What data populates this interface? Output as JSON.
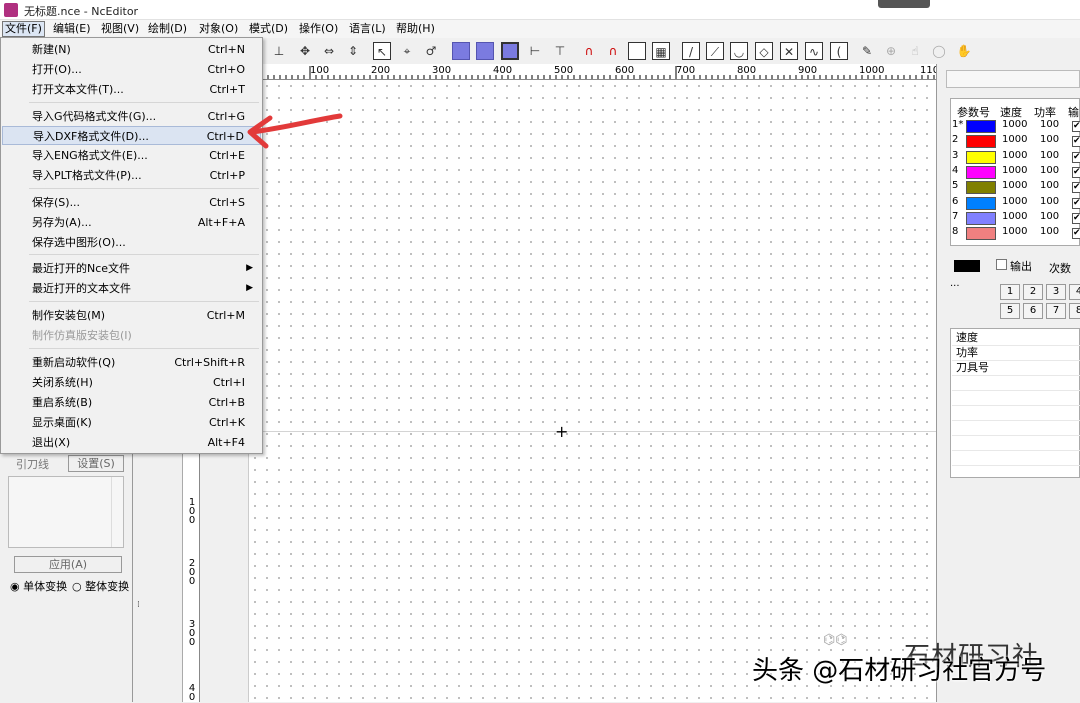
{
  "window": {
    "title": "无标题.nce - NcEditor"
  },
  "menubar": [
    {
      "label": "文件(F)"
    },
    {
      "label": "编辑(E)"
    },
    {
      "label": "视图(V)"
    },
    {
      "label": "绘制(D)"
    },
    {
      "label": "对象(O)"
    },
    {
      "label": "模式(D)"
    },
    {
      "label": "操作(O)"
    },
    {
      "label": "语言(L)"
    },
    {
      "label": "帮助(H)"
    }
  ],
  "file_menu": [
    {
      "label": "新建(N)",
      "shortcut": "Ctrl+N"
    },
    {
      "label": "打开(O)...",
      "shortcut": "Ctrl+O"
    },
    {
      "label": "打开文本文件(T)...",
      "shortcut": "Ctrl+T"
    },
    {
      "label": "导入G代码格式文件(G)...",
      "shortcut": "Ctrl+G"
    },
    {
      "label": "导入DXF格式文件(D)...",
      "shortcut": "Ctrl+D"
    },
    {
      "label": "导入ENG格式文件(E)...",
      "shortcut": "Ctrl+E"
    },
    {
      "label": "导入PLT格式文件(P)...",
      "shortcut": "Ctrl+P"
    },
    {
      "label": "保存(S)...",
      "shortcut": "Ctrl+S"
    },
    {
      "label": "另存为(A)...",
      "shortcut": "Alt+F+A"
    },
    {
      "label": "保存选中图形(O)...",
      "shortcut": ""
    },
    {
      "label": "最近打开的Nce文件",
      "shortcut": "▶"
    },
    {
      "label": "最近打开的文本文件",
      "shortcut": "▶"
    },
    {
      "label": "制作安装包(M)",
      "shortcut": "Ctrl+M"
    },
    {
      "label": "制作仿真版安装包(I)",
      "shortcut": ""
    },
    {
      "label": "重新启动软件(Q)",
      "shortcut": "Ctrl+Shift+R"
    },
    {
      "label": "关闭系统(H)",
      "shortcut": "Ctrl+I"
    },
    {
      "label": "重启系统(B)",
      "shortcut": "Ctrl+B"
    },
    {
      "label": "显示桌面(K)",
      "shortcut": "Ctrl+K"
    },
    {
      "label": "退出(X)",
      "shortcut": "Alt+F4"
    }
  ],
  "ruler_top": [
    "100",
    "200",
    "300",
    "400",
    "500",
    "600",
    "700",
    "800",
    "900",
    "1000",
    "110"
  ],
  "ruler_left": [
    "1\n0\n0",
    "2\n0\n0",
    "3\n0\n0",
    "4\n0"
  ],
  "left_panel": {
    "lead_line": "引刀线",
    "settings": "设置(S)",
    "apply": "应用(A)",
    "single": "单体变换",
    "whole": "整体变换"
  },
  "param_table": {
    "headers": [
      "参数号",
      "速度",
      "功率",
      "输"
    ],
    "rows": [
      {
        "num": "1*",
        "color": "#0000ff",
        "speed": "1000",
        "power": "100"
      },
      {
        "num": "2",
        "color": "#ff0000",
        "speed": "1000",
        "power": "100"
      },
      {
        "num": "3",
        "color": "#ffff00",
        "speed": "1000",
        "power": "100"
      },
      {
        "num": "4",
        "color": "#ff00ff",
        "speed": "1000",
        "power": "100"
      },
      {
        "num": "5",
        "color": "#808000",
        "speed": "1000",
        "power": "100"
      },
      {
        "num": "6",
        "color": "#0080ff",
        "speed": "1000",
        "power": "100"
      },
      {
        "num": "7",
        "color": "#8080ff",
        "speed": "1000",
        "power": "100"
      },
      {
        "num": "8",
        "color": "#f08080",
        "speed": "1000",
        "power": "100"
      }
    ]
  },
  "output": {
    "label": "输出",
    "times": "次数",
    "dots": "...",
    "buttons": [
      "1",
      "2",
      "3",
      "4",
      "5",
      "6",
      "7",
      "8"
    ]
  },
  "props": [
    "速度",
    "功率",
    "刀具号"
  ],
  "watermark": {
    "text": "石材研习社"
  },
  "caption": "头条 @石材研习社官方号"
}
